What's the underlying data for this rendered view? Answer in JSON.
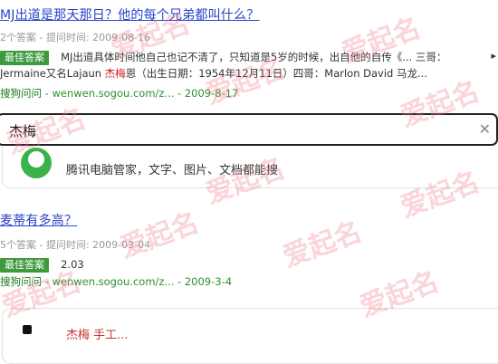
{
  "results": [
    {
      "title": "MJ出道是那天那日？他的每个兄弟都叫什么？",
      "meta": "2个答案 - 提问时间: 2009-08-16",
      "badge": "最佳答案",
      "snippet_line1": "MJ出道具体时间他自己也记不清了，只知道是5岁的时候，出自他的自传《... 三哥：",
      "snippet_line2_pre": "Jermaine又名Lajaun ",
      "snippet_line2_hl": "杰梅",
      "snippet_line2_post": "恩（出生日期：1954年12月11日）四哥：Marlon David 马龙...",
      "source_brand": "搜狗问问",
      "source_rest": " - wenwen.sogou.com/z... - 2009-8-17"
    },
    {
      "title": "麦蒂有多高？",
      "meta": "5个答案 - 提问时间: 2009-03-04",
      "badge": "最佳答案",
      "answer": "2.03",
      "source_brand": "搜狗问问",
      "source_rest": " - wenwen.sogou.com/z... - 2009-3-4"
    }
  ],
  "search": {
    "query": "杰梅",
    "clear_icon": "close-icon"
  },
  "promo_card": {
    "text": "腾讯电脑管家，文字、图片、文档都能搜"
  },
  "bottom_card": {
    "partial_text": "杰梅 手工..."
  },
  "watermark": "爱起名"
}
